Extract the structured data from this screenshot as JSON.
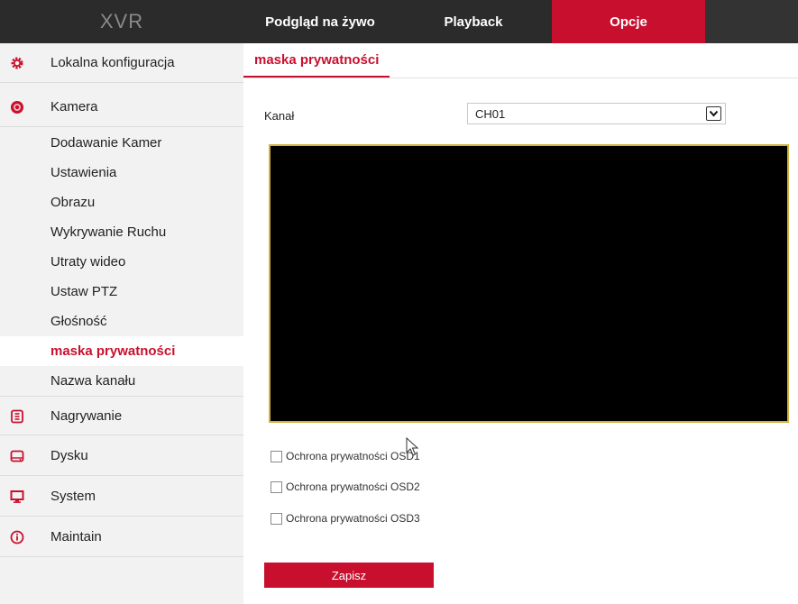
{
  "header": {
    "brand": "XVR",
    "tabs": [
      {
        "label": "Podgląd na żywo"
      },
      {
        "label": "Playback"
      },
      {
        "label": "Opcje"
      }
    ]
  },
  "sidebar": {
    "groups": [
      {
        "label": "Lokalna konfiguracja",
        "icon": "gear-icon"
      },
      {
        "label": "Kamera",
        "icon": "camera-icon"
      },
      {
        "label": "Nagrywanie",
        "icon": "record-icon"
      },
      {
        "label": "Dysku",
        "icon": "disk-icon"
      },
      {
        "label": "System",
        "icon": "monitor-icon"
      },
      {
        "label": "Maintain",
        "icon": "info-icon"
      }
    ],
    "camera_items": [
      {
        "label": "Dodawanie Kamer"
      },
      {
        "label": "Ustawienia"
      },
      {
        "label": "Obrazu"
      },
      {
        "label": "Wykrywanie Ruchu"
      },
      {
        "label": "Utraty wideo"
      },
      {
        "label": "Ustaw PTZ"
      },
      {
        "label": "Głośność"
      },
      {
        "label": "maska prywatności"
      },
      {
        "label": "Nazwa kanału"
      }
    ]
  },
  "main": {
    "tab_title": "maska prywatności",
    "channel_label": "Kanał",
    "channel_value": "CH01",
    "checkboxes": [
      {
        "label": "Ochrona prywatności OSD1",
        "checked": false
      },
      {
        "label": "Ochrona prywatności OSD2",
        "checked": false
      },
      {
        "label": "Ochrona prywatności OSD3",
        "checked": false
      }
    ],
    "save_label": "Zapisz"
  },
  "colors": {
    "accent": "#c8102e",
    "topbar": "#2b2b2b",
    "sidebar_bg": "#f2f2f2",
    "preview_border": "#d4b13a"
  }
}
